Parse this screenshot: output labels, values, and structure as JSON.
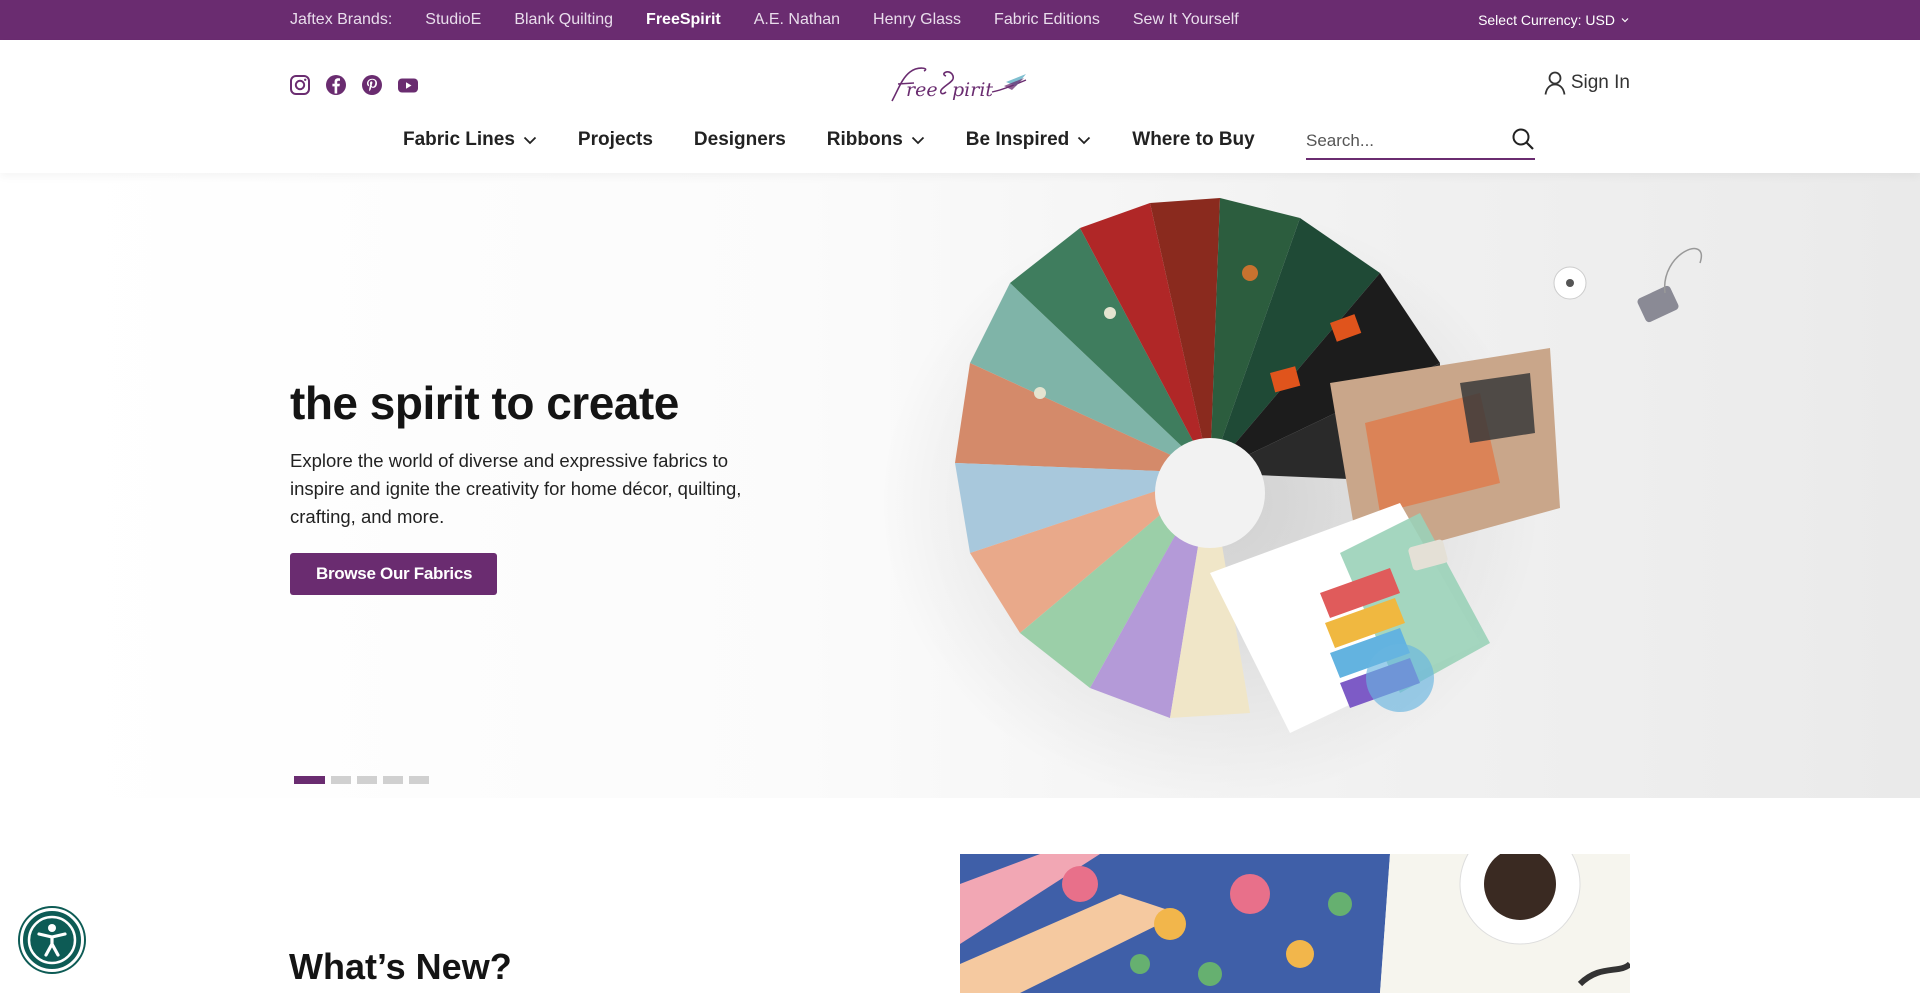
{
  "brandbar": {
    "label": "Jaftex Brands:",
    "brands": [
      "StudioE",
      "Blank Quilting",
      "FreeSpirit",
      "A.E. Nathan",
      "Henry Glass",
      "Fabric Editions",
      "Sew It Yourself"
    ],
    "active_brand": "FreeSpirit",
    "currency": "Select Currency: USD"
  },
  "header": {
    "logo_text": "FreeSpirit",
    "social_icons": [
      "instagram-icon",
      "facebook-icon",
      "pinterest-icon",
      "youtube-icon"
    ],
    "signin_label": "Sign In",
    "nav": [
      {
        "label": "Fabric Lines",
        "dropdown": true
      },
      {
        "label": "Projects",
        "dropdown": false
      },
      {
        "label": "Designers",
        "dropdown": false
      },
      {
        "label": "Ribbons",
        "dropdown": true
      },
      {
        "label": "Be Inspired",
        "dropdown": true
      },
      {
        "label": "Where to Buy",
        "dropdown": false
      }
    ],
    "search_placeholder": "Search..."
  },
  "hero": {
    "title": "the spirit to create",
    "subtitle": "Explore the world of diverse and expressive fabrics to inspire and ignite the creativity for home décor, quilting, crafting, and more.",
    "button_label": "Browse Our Fabrics",
    "slide_count": 5,
    "active_slide": 1
  },
  "whatsnew": {
    "title": "What’s New?"
  },
  "colors": {
    "brand_purple": "#6a2c70",
    "accessibility_teal": "#0d5b55"
  }
}
